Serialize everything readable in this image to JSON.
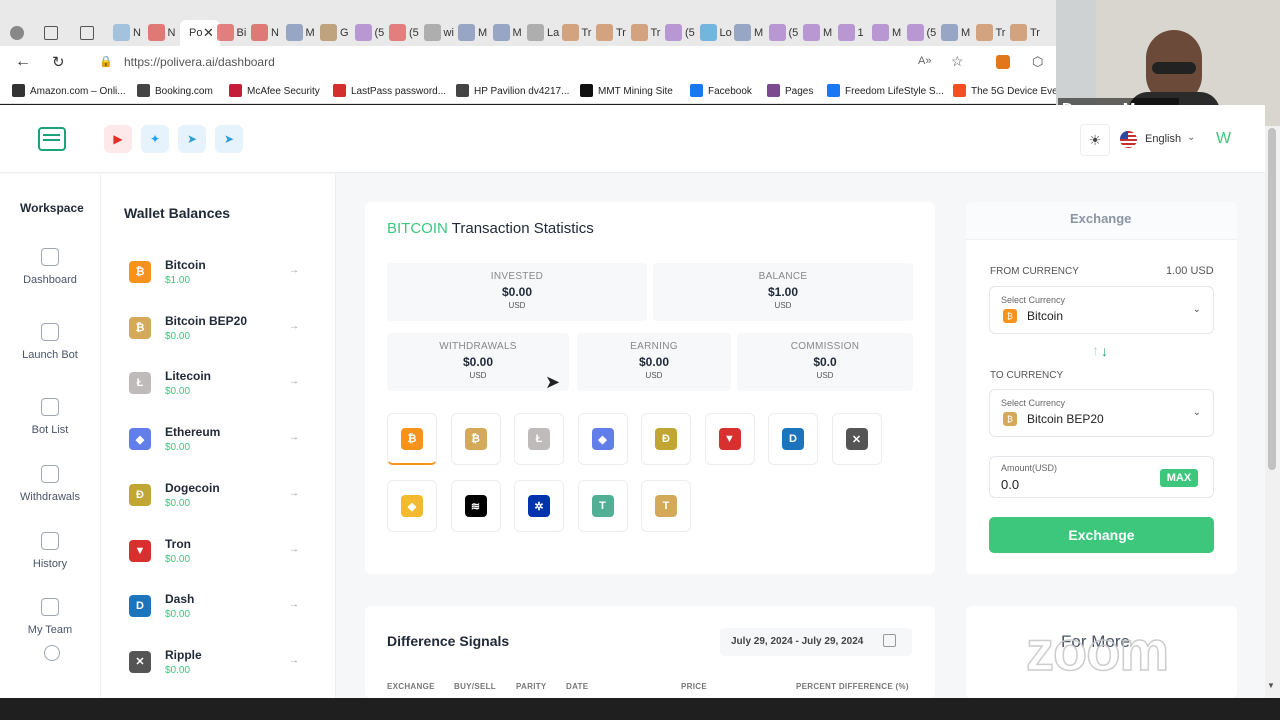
{
  "browser": {
    "tab_labels": [
      "N",
      "N",
      "Po",
      "Bi",
      "N",
      "M",
      "G",
      "(5",
      "(5",
      "wi",
      "M",
      "M",
      "La",
      "Tr",
      "Tr",
      "Tr",
      "(5",
      "Lo",
      "M",
      "(5",
      "M",
      "1",
      "M",
      "(5",
      "M",
      "Tr",
      "Tr"
    ],
    "url": "https://polivera.ai/dashboard",
    "bookmarks": [
      "Amazon.com – Onli...",
      "Booking.com",
      "McAfee Security",
      "LastPass password...",
      "HP Pavilion dv4217...",
      "MMT Mining Site",
      "Facebook",
      "Pages",
      "Freedom LifeStyle S...",
      "The 5G Device Even..."
    ]
  },
  "video": {
    "participant_name": "Dwayne Moon..."
  },
  "header": {
    "language": "English",
    "avatar_letter": "W"
  },
  "nav": {
    "title": "Workspace",
    "items": [
      "Dashboard",
      "Launch Bot",
      "Bot List",
      "Withdrawals",
      "History",
      "My Team"
    ]
  },
  "wallet": {
    "title": "Wallet Balances",
    "items": [
      {
        "name": "Bitcoin",
        "value": "$1.00",
        "color": "#f7931a",
        "glyph": "₿"
      },
      {
        "name": "Bitcoin BEP20",
        "value": "$0.00",
        "color": "#d4aa5a",
        "glyph": "₿"
      },
      {
        "name": "Litecoin",
        "value": "$0.00",
        "color": "#bfbbbb",
        "glyph": "Ł"
      },
      {
        "name": "Ethereum",
        "value": "$0.00",
        "color": "#627eea",
        "glyph": "◆"
      },
      {
        "name": "Dogecoin",
        "value": "$0.00",
        "color": "#c2a633",
        "glyph": "Ð"
      },
      {
        "name": "Tron",
        "value": "$0.00",
        "color": "#d8302f",
        "glyph": "▼"
      },
      {
        "name": "Dash",
        "value": "$0.00",
        "color": "#1c75bc",
        "glyph": "D"
      },
      {
        "name": "Ripple",
        "value": "$0.00",
        "color": "#555555",
        "glyph": "✕"
      }
    ]
  },
  "stats": {
    "title_coin": "BITCOIN",
    "title_rest": "Transaction Statistics",
    "invested_label": "INVESTED",
    "invested": "$0.00",
    "balance_label": "BALANCE",
    "balance": "$1.00",
    "withdrawals_label": "WITHDRAWALS",
    "withdrawals": "$0.00",
    "earning_label": "EARNING",
    "earning": "$0.00",
    "commission_label": "COMMISSION",
    "commission": "$0.0",
    "unit": "USD",
    "coins": [
      {
        "color": "#f7931a",
        "glyph": "₿"
      },
      {
        "color": "#d4aa5a",
        "glyph": "₿"
      },
      {
        "color": "#bfbbbb",
        "glyph": "Ł"
      },
      {
        "color": "#627eea",
        "glyph": "◆"
      },
      {
        "color": "#c2a633",
        "glyph": "Ð"
      },
      {
        "color": "#d8302f",
        "glyph": "▼"
      },
      {
        "color": "#1c75bc",
        "glyph": "D"
      },
      {
        "color": "#555555",
        "glyph": "✕"
      },
      {
        "color": "#f3ba2f",
        "glyph": "◆"
      },
      {
        "color": "#000000",
        "glyph": "≋"
      },
      {
        "color": "#0033ad",
        "glyph": "✲"
      },
      {
        "color": "#50af95",
        "glyph": "T"
      },
      {
        "color": "#d4aa5a",
        "glyph": "T"
      }
    ]
  },
  "exchange": {
    "title": "Exchange",
    "from_label": "FROM CURRENCY",
    "from_amount": "1.00 USD",
    "select_hint": "Select Currency",
    "from_value": "Bitcoin",
    "to_label": "TO CURRENCY",
    "to_value": "Bitcoin BEP20",
    "amount_label": "Amount(USD)",
    "amount_value": "0.0",
    "max_label": "MAX",
    "button_label": "Exchange"
  },
  "signals": {
    "title": "Difference Signals",
    "date_range": "July 29, 2024 - July 29, 2024",
    "columns": [
      "EXCHANGE",
      "BUY/SELL",
      "PARITY",
      "DATE",
      "PRICE",
      "PERCENT DIFFERENCE (%)"
    ]
  },
  "for_more": {
    "title": "For More"
  },
  "zoom_watermark": "zoom"
}
